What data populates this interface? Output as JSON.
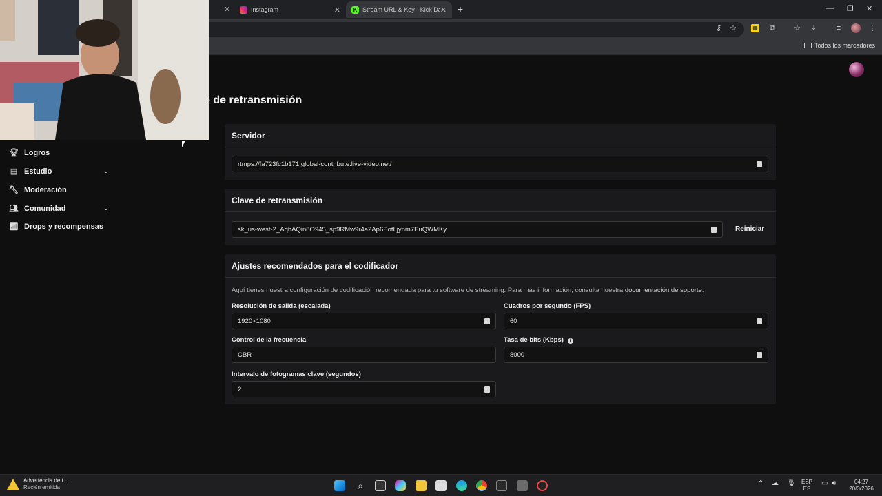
{
  "browser": {
    "tabs": [
      {
        "title": "Instagram",
        "icon": "instagram-icon"
      },
      {
        "title": "Stream URL & Key - Kick Dashb",
        "icon": "kick-icon"
      }
    ],
    "bookmarks_all": "Todos los marcadores"
  },
  "sidebar": {
    "items": [
      {
        "label": "Logros",
        "icon": "trophy-icon"
      },
      {
        "label": "Estudio",
        "icon": "studio-icon",
        "expandable": true
      },
      {
        "label": "Moderación",
        "icon": "wrench-icon"
      },
      {
        "label": "Comunidad",
        "icon": "community-icon",
        "expandable": true
      },
      {
        "label": "Drops y recompensas",
        "icon": "drops-icon"
      }
    ]
  },
  "page": {
    "title": "e de retransmisión"
  },
  "server": {
    "header": "Servidor",
    "url": "rtmps://fa723fc1b171.global-contribute.live-video.net/"
  },
  "key": {
    "header": "Clave de retransmisión",
    "value": "sk_us-west-2_AqbAQin8O945_sp9RMw9r4a2Ap6EotLjynm7EuQWMKy",
    "reset_label": "Reiniciar"
  },
  "encoder": {
    "header": "Ajustes recomendados para el codificador",
    "desc_prefix": "Aquí tienes nuestra configuración de codificación recomendada para tu software de streaming. Para más información, consulta nuestra ",
    "desc_link": "documentación de soporte",
    "desc_suffix": ".",
    "resolution_label": "Resolución de salida (escalada)",
    "resolution_value": "1920×1080",
    "fps_label": "Cuadros por segundo (FPS)",
    "fps_value": "60",
    "rate_control_label": "Control de la frecuencia",
    "rate_control_value": "CBR",
    "bitrate_label": "Tasa de bits (Kbps)",
    "bitrate_value": "8000",
    "keyframe_label": "Intervalo de fotogramas clave (segundos)",
    "keyframe_value": "2"
  },
  "taskbar": {
    "notification_title": "Advertencia de t...",
    "notification_sub": "Recién emitida",
    "lang_top": "ESP",
    "lang_bottom": "ES",
    "time": "04:27",
    "date": "20/3/2026"
  },
  "colors": {
    "kick_green": "#53fc18",
    "background": "#0f0f10",
    "card": "#1a1a1c"
  }
}
